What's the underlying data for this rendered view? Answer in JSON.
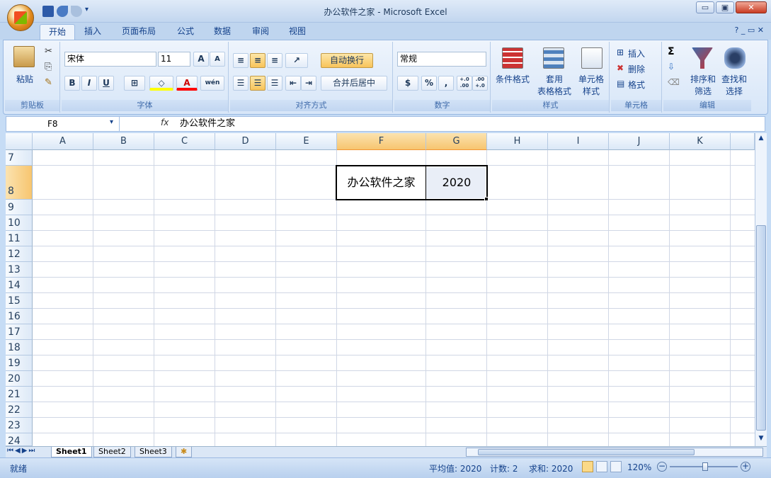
{
  "window": {
    "title": "办公软件之家 - Microsoft Excel",
    "minimize": "▭",
    "restore": "▣",
    "close": "✕"
  },
  "ribbon_tabs": [
    "开始",
    "插入",
    "页面布局",
    "公式",
    "数据",
    "审阅",
    "视图"
  ],
  "clipboard": {
    "paste": "粘贴",
    "label": "剪贴板"
  },
  "font": {
    "name": "宋体",
    "size": "11",
    "label": "字体",
    "bold": "B",
    "italic": "I",
    "underline": "U",
    "grow": "A",
    "shrink": "A",
    "color_letter": "A",
    "wen": "wén"
  },
  "alignment": {
    "wrap_text": "自动换行",
    "merge_center": "合并后居中",
    "label": "对齐方式"
  },
  "number": {
    "format": "常规",
    "percent": "%",
    "comma": ",",
    "inc_decimal": "+.0 .00",
    "dec_decimal": ".00 +.0",
    "label": "数字"
  },
  "styles": {
    "conditional": "条件格式",
    "table_line1": "套用",
    "table_line2": "表格格式",
    "cell_line1": "单元格",
    "cell_line2": "样式",
    "label": "样式"
  },
  "cells": {
    "insert": "插入",
    "delete": "删除",
    "format": "格式",
    "label": "单元格"
  },
  "editing": {
    "sort_line1": "排序和",
    "sort_line2": "筛选",
    "find_line1": "查找和",
    "find_line2": "选择",
    "sigma": "Σ",
    "label": "编辑"
  },
  "formula_bar": {
    "name_box": "F8",
    "fx": "fx",
    "content": "办公软件之家"
  },
  "columns": [
    "A",
    "B",
    "C",
    "D",
    "E",
    "F",
    "G",
    "H",
    "I",
    "J",
    "K"
  ],
  "rows": [
    "7",
    "8",
    "9",
    "10",
    "11",
    "12",
    "13",
    "14",
    "15",
    "16",
    "17",
    "18",
    "19",
    "20",
    "21",
    "22",
    "23",
    "24"
  ],
  "cell_values": {
    "F8": "办公软件之家",
    "G8": "2020"
  },
  "sheets": [
    "Sheet1",
    "Sheet2",
    "Sheet3"
  ],
  "status": {
    "ready": "就绪",
    "average": "平均值: 2020",
    "count": "计数: 2",
    "sum": "求和: 2020",
    "zoom": "120%"
  }
}
